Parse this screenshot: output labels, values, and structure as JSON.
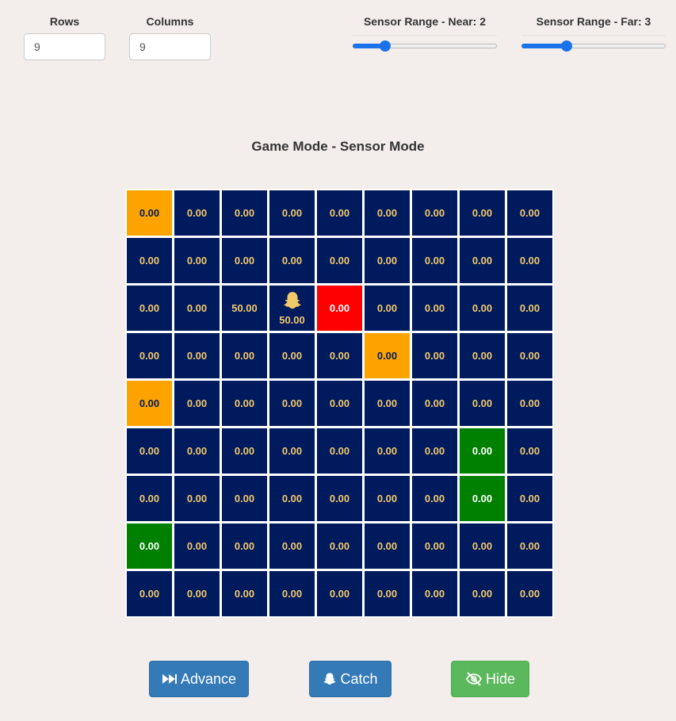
{
  "controls": {
    "rows": {
      "label": "Rows",
      "value": "9"
    },
    "columns": {
      "label": "Columns",
      "value": "9"
    },
    "sensor_near": {
      "label": "Sensor Range - Near: 2",
      "value": 2,
      "min": 0,
      "max": 10
    },
    "sensor_far": {
      "label": "Sensor Range - Far: 3",
      "value": 3,
      "min": 0,
      "max": 10
    }
  },
  "title": "Game Mode - Sensor Mode",
  "grid": {
    "cells": [
      [
        {
          "v": "0.00",
          "c": "orange"
        },
        {
          "v": "0.00"
        },
        {
          "v": "0.00"
        },
        {
          "v": "0.00"
        },
        {
          "v": "0.00"
        },
        {
          "v": "0.00"
        },
        {
          "v": "0.00"
        },
        {
          "v": "0.00"
        },
        {
          "v": "0.00"
        }
      ],
      [
        {
          "v": "0.00"
        },
        {
          "v": "0.00"
        },
        {
          "v": "0.00"
        },
        {
          "v": "0.00"
        },
        {
          "v": "0.00"
        },
        {
          "v": "0.00"
        },
        {
          "v": "0.00"
        },
        {
          "v": "0.00"
        },
        {
          "v": "0.00"
        }
      ],
      [
        {
          "v": "0.00"
        },
        {
          "v": "0.00"
        },
        {
          "v": "50.00"
        },
        {
          "v": "50.00",
          "icon": "ghost-icon"
        },
        {
          "v": "0.00",
          "c": "red"
        },
        {
          "v": "0.00"
        },
        {
          "v": "0.00"
        },
        {
          "v": "0.00"
        },
        {
          "v": "0.00"
        }
      ],
      [
        {
          "v": "0.00"
        },
        {
          "v": "0.00"
        },
        {
          "v": "0.00"
        },
        {
          "v": "0.00"
        },
        {
          "v": "0.00"
        },
        {
          "v": "0.00",
          "c": "orange"
        },
        {
          "v": "0.00"
        },
        {
          "v": "0.00"
        },
        {
          "v": "0.00"
        }
      ],
      [
        {
          "v": "0.00",
          "c": "orange"
        },
        {
          "v": "0.00"
        },
        {
          "v": "0.00"
        },
        {
          "v": "0.00"
        },
        {
          "v": "0.00"
        },
        {
          "v": "0.00"
        },
        {
          "v": "0.00"
        },
        {
          "v": "0.00"
        },
        {
          "v": "0.00"
        }
      ],
      [
        {
          "v": "0.00"
        },
        {
          "v": "0.00"
        },
        {
          "v": "0.00"
        },
        {
          "v": "0.00"
        },
        {
          "v": "0.00"
        },
        {
          "v": "0.00"
        },
        {
          "v": "0.00"
        },
        {
          "v": "0.00",
          "c": "green"
        },
        {
          "v": "0.00"
        }
      ],
      [
        {
          "v": "0.00"
        },
        {
          "v": "0.00"
        },
        {
          "v": "0.00"
        },
        {
          "v": "0.00"
        },
        {
          "v": "0.00"
        },
        {
          "v": "0.00"
        },
        {
          "v": "0.00"
        },
        {
          "v": "0.00",
          "c": "green"
        },
        {
          "v": "0.00"
        }
      ],
      [
        {
          "v": "0.00",
          "c": "green"
        },
        {
          "v": "0.00"
        },
        {
          "v": "0.00"
        },
        {
          "v": "0.00"
        },
        {
          "v": "0.00"
        },
        {
          "v": "0.00"
        },
        {
          "v": "0.00"
        },
        {
          "v": "0.00"
        },
        {
          "v": "0.00"
        }
      ],
      [
        {
          "v": "0.00"
        },
        {
          "v": "0.00"
        },
        {
          "v": "0.00"
        },
        {
          "v": "0.00"
        },
        {
          "v": "0.00"
        },
        {
          "v": "0.00"
        },
        {
          "v": "0.00"
        },
        {
          "v": "0.00"
        },
        {
          "v": "0.00"
        }
      ]
    ]
  },
  "colors": {
    "cell_default": "#001a5e",
    "cell_text": "#f3c96a",
    "orange": "#fca300",
    "red": "#fe0000",
    "green": "#008000",
    "slider_accent": "#1a73e8"
  },
  "buttons": {
    "advance": {
      "label": "Advance",
      "icon": "fast-forward-icon"
    },
    "catch": {
      "label": "Catch",
      "icon": "ghost-icon"
    },
    "hide": {
      "label": "Hide",
      "icon": "eye-slash-icon"
    }
  }
}
